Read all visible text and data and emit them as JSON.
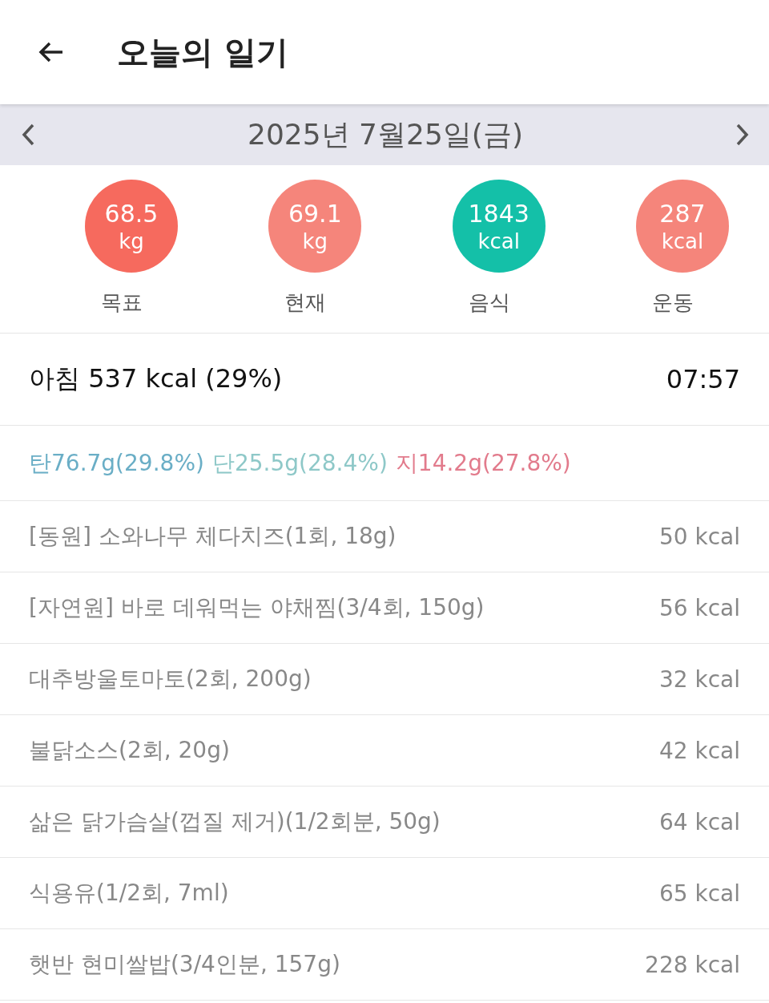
{
  "header": {
    "title": "오늘의 일기"
  },
  "date_bar": {
    "date": "2025년 7월25일(금)"
  },
  "stats": [
    {
      "value": "68.5",
      "unit": "kg",
      "label": "목표",
      "color": "#f66a5e"
    },
    {
      "value": "69.1",
      "unit": "kg",
      "label": "현재",
      "color": "#f5857b"
    },
    {
      "value": "1843",
      "unit": "kcal",
      "label": "음식",
      "color": "#14c0a8"
    },
    {
      "value": "287",
      "unit": "kcal",
      "label": "운동",
      "color": "#f5857b"
    }
  ],
  "meal": {
    "title": "아침 537 kcal (29%)",
    "time": "07:57"
  },
  "macros": [
    {
      "text": "탄76.7g(29.8%)",
      "color": "#6aaec6"
    },
    {
      "text": "단25.5g(28.4%)",
      "color": "#8ec8c8"
    },
    {
      "text": "지14.2g(27.8%)",
      "color": "#e27b8c"
    }
  ],
  "foods": [
    {
      "name": "[동원] 소와나무 체다치즈(1회, 18g)",
      "kcal": "50 kcal"
    },
    {
      "name": "[자연원] 바로 데워먹는 야채찜(3/4회, 150g)",
      "kcal": "56 kcal"
    },
    {
      "name": "대추방울토마토(2회, 200g)",
      "kcal": "32 kcal"
    },
    {
      "name": "불닭소스(2회, 20g)",
      "kcal": "42 kcal"
    },
    {
      "name": "삶은 닭가슴살(껍질 제거)(1/2회분, 50g)",
      "kcal": "64 kcal"
    },
    {
      "name": "식용유(1/2회, 7ml)",
      "kcal": "65 kcal"
    },
    {
      "name": "햇반 현미쌀밥(3/4인분, 157g)",
      "kcal": "228 kcal"
    }
  ]
}
